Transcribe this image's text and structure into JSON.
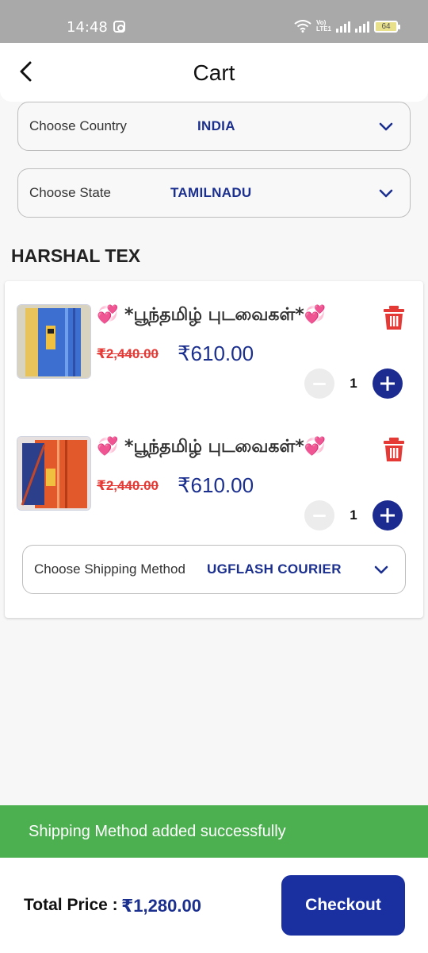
{
  "status_bar": {
    "time": "14:48",
    "battery": "64",
    "network_label": "Vo) LTE1"
  },
  "header": {
    "title": "Cart"
  },
  "location": {
    "country": {
      "label": "Choose Country",
      "value": "INDIA"
    },
    "state": {
      "label": "Choose State",
      "value": "TAMILNADU"
    }
  },
  "seller": {
    "name": "HARSHAL TEX"
  },
  "items": [
    {
      "name": "💞 *பூந்தமிழ் புடவைகள்*💞",
      "old_price": "₹2,440.00",
      "price": "₹610.00",
      "qty": "1",
      "thumb_color": "#3d6fd1"
    },
    {
      "name": "💞 *பூந்தமிழ் புடவைகள்*💞",
      "old_price": "₹2,440.00",
      "price": "₹610.00",
      "qty": "1",
      "thumb_color": "#e2592c"
    }
  ],
  "shipping": {
    "label": "Choose Shipping Method",
    "value": "UGFLASH COURIER"
  },
  "toast": {
    "message": "Shipping Method added successfully"
  },
  "footer": {
    "total_label": "Total Price :",
    "total_value": "₹1,280.00",
    "checkout_label": "Checkout"
  },
  "colors": {
    "accent": "#1b2f8f",
    "danger": "#e53935",
    "success": "#4caf50"
  }
}
